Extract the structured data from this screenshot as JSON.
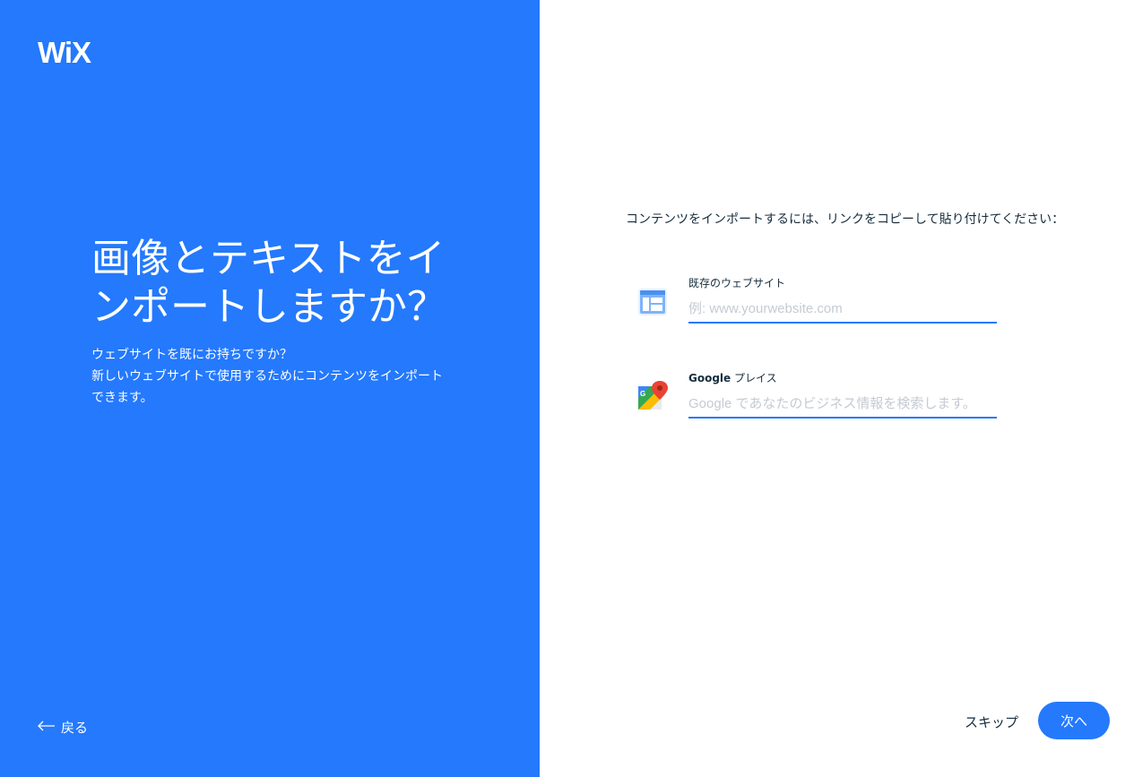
{
  "brand": {
    "logo_text": "WiX",
    "accent": "#2479fd"
  },
  "left": {
    "headline_line1": "画像とテキストをイ",
    "headline_line2": "ンポートしますか？",
    "sub_line1": "ウェブサイトを既にお持ちですか？",
    "sub_line2": "新しいウェブサイトで使用するためにコンテンツをインポート",
    "sub_line3": "できます。",
    "back_label": "戻る"
  },
  "right": {
    "instruction": "コンテンツをインポートするには、リンクをコピーして貼り付けてください：",
    "website": {
      "label": "既存のウェブサイト",
      "placeholder": "例: www.yourwebsite.com",
      "value": ""
    },
    "google_place": {
      "label_bold": "Google",
      "label_rest": " プレイス",
      "placeholder": "Google であなたのビジネス情報を検索します。",
      "value": ""
    },
    "skip_label": "スキップ",
    "next_label": "次へ"
  }
}
